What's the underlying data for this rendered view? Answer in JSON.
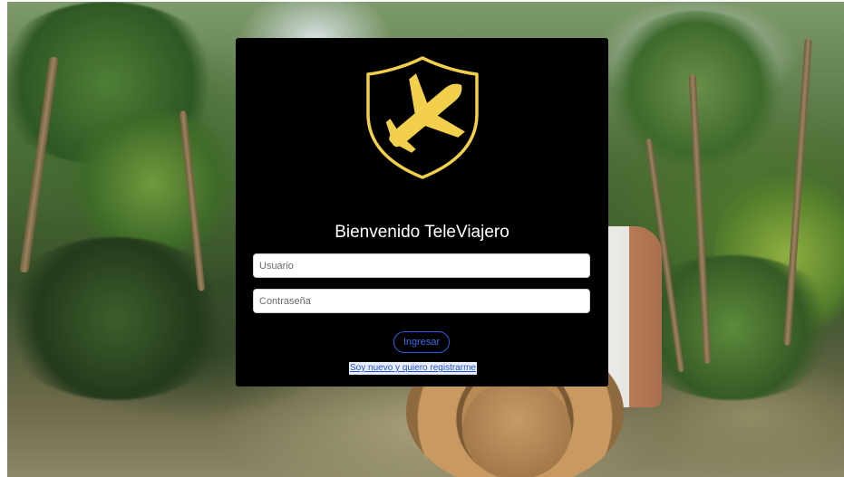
{
  "login": {
    "title": "Bienvenido TeleViajero",
    "username_placeholder": "Usuario",
    "password_placeholder": "Contraseña",
    "submit_label": "Ingresar",
    "register_link": "Soy nuevo y quiero registrarme"
  },
  "logo": {
    "icon": "airplane-shield-icon"
  },
  "colors": {
    "card_background": "#000000",
    "logo_accent": "#f2d04b",
    "button_accent": "#2d5be3",
    "link_color": "#1f4fd8"
  }
}
